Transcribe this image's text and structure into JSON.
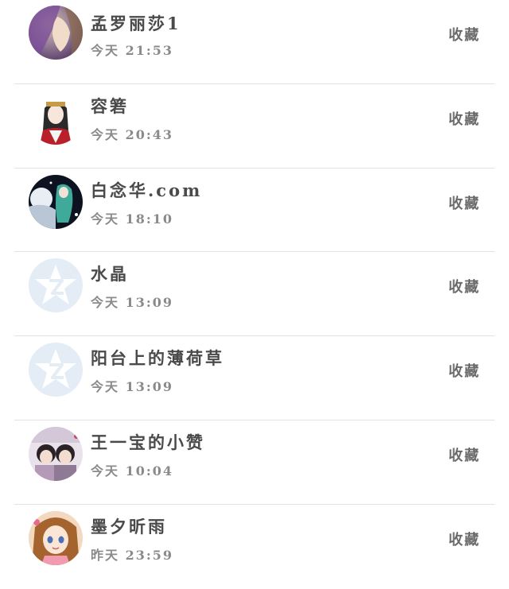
{
  "contacts": [
    {
      "name": "孟罗丽莎1",
      "time": "今天 21:53",
      "action": "收藏",
      "avatar": "purple-hair-girl"
    },
    {
      "name": "容箬",
      "time": "今天 20:43",
      "action": "收藏",
      "avatar": "anime-girl-headdress"
    },
    {
      "name": "白念华.com",
      "time": "今天 18:10",
      "action": "收藏",
      "avatar": "night-scene"
    },
    {
      "name": "水晶",
      "time": "今天 13:09",
      "action": "收藏",
      "avatar": "default-qq-icon"
    },
    {
      "name": "阳台上的薄荷草",
      "time": "今天 13:09",
      "action": "收藏",
      "avatar": "default-qq-icon"
    },
    {
      "name": "王一宝的小赞",
      "time": "今天 10:04",
      "action": "收藏",
      "avatar": "two-kids-photo"
    },
    {
      "name": "墨夕昕雨",
      "time": "昨天 23:59",
      "action": "收藏",
      "avatar": "brown-hair-girl"
    }
  ],
  "colors": {
    "default_avatar_bg": "#e4ecf6",
    "default_avatar_star": "#ffffff",
    "divider": "#e3e3e3"
  }
}
